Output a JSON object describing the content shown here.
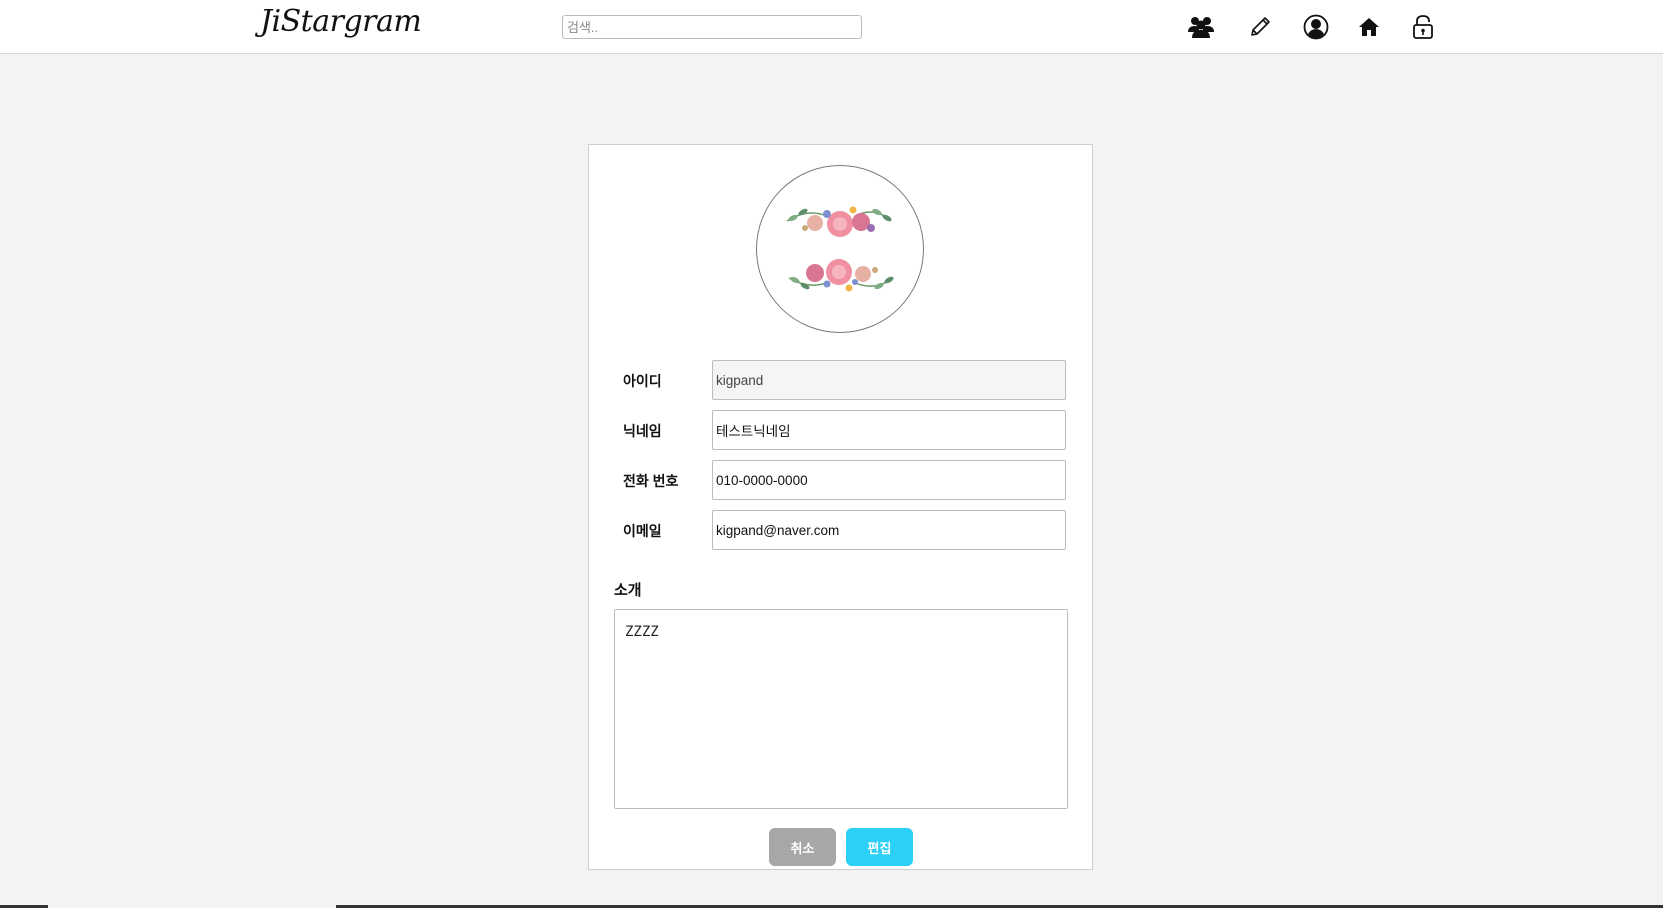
{
  "header": {
    "logo": "JiStargram",
    "search_placeholder": "검색..",
    "nav": [
      {
        "icon": "users-icon"
      },
      {
        "icon": "pencil-icon"
      },
      {
        "icon": "user-circle-icon"
      },
      {
        "icon": "home-icon"
      },
      {
        "icon": "unlock-icon"
      }
    ]
  },
  "profile": {
    "avatar": "floral-wreath-image",
    "fields": {
      "id": {
        "label": "아이디",
        "value": "kigpand"
      },
      "nickname": {
        "label": "닉네임",
        "value": "테스트닉네임"
      },
      "phone": {
        "label": "전화 번호",
        "value": "010-0000-0000"
      },
      "email": {
        "label": "이메일",
        "value": "kigpand@naver.com"
      }
    },
    "intro": {
      "label": "소개",
      "value": "ZZZZ"
    },
    "buttons": {
      "cancel": "취소",
      "edit": "편집"
    }
  },
  "colors": {
    "accent": "#2bd0f7",
    "cancel": "#a7a7a7",
    "background": "#f3f3f3"
  }
}
